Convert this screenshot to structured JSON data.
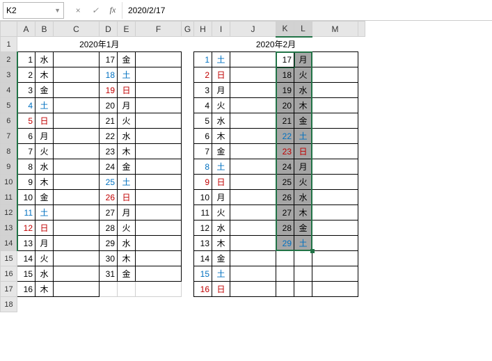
{
  "formula_bar": {
    "cell_ref": "K2",
    "value": "2020/2/17"
  },
  "icons": {
    "cancel": "×",
    "confirm": "✓",
    "fx": "fx"
  },
  "col_headers": [
    "A",
    "B",
    "C",
    "D",
    "E",
    "F",
    "G",
    "H",
    "I",
    "J",
    "K",
    "L",
    "M",
    ""
  ],
  "row_headers": [
    "1",
    "2",
    "3",
    "4",
    "5",
    "6",
    "7",
    "8",
    "9",
    "10",
    "11",
    "12",
    "13",
    "14",
    "15",
    "16",
    "17",
    "18"
  ],
  "month1": "2020年1月",
  "month2": "2020年2月",
  "jan_left": [
    {
      "d": "1",
      "w": "水"
    },
    {
      "d": "2",
      "w": "木"
    },
    {
      "d": "3",
      "w": "金"
    },
    {
      "d": "4",
      "w": "土",
      "c": "blue"
    },
    {
      "d": "5",
      "w": "日",
      "c": "red"
    },
    {
      "d": "6",
      "w": "月"
    },
    {
      "d": "7",
      "w": "火"
    },
    {
      "d": "8",
      "w": "水"
    },
    {
      "d": "9",
      "w": "木"
    },
    {
      "d": "10",
      "w": "金"
    },
    {
      "d": "11",
      "w": "土",
      "c": "blue"
    },
    {
      "d": "12",
      "w": "日",
      "c": "red"
    },
    {
      "d": "13",
      "w": "月"
    },
    {
      "d": "14",
      "w": "火"
    },
    {
      "d": "15",
      "w": "水"
    },
    {
      "d": "16",
      "w": "木"
    }
  ],
  "jan_right": [
    {
      "d": "17",
      "w": "金"
    },
    {
      "d": "18",
      "w": "土",
      "c": "blue"
    },
    {
      "d": "19",
      "w": "日",
      "c": "red"
    },
    {
      "d": "20",
      "w": "月"
    },
    {
      "d": "21",
      "w": "火"
    },
    {
      "d": "22",
      "w": "水"
    },
    {
      "d": "23",
      "w": "木"
    },
    {
      "d": "24",
      "w": "金"
    },
    {
      "d": "25",
      "w": "土",
      "c": "blue"
    },
    {
      "d": "26",
      "w": "日",
      "c": "red"
    },
    {
      "d": "27",
      "w": "月"
    },
    {
      "d": "28",
      "w": "火"
    },
    {
      "d": "29",
      "w": "水"
    },
    {
      "d": "30",
      "w": "木"
    },
    {
      "d": "31",
      "w": "金"
    }
  ],
  "feb_left": [
    {
      "d": "1",
      "w": "土",
      "c": "blue"
    },
    {
      "d": "2",
      "w": "日",
      "c": "red"
    },
    {
      "d": "3",
      "w": "月"
    },
    {
      "d": "4",
      "w": "火"
    },
    {
      "d": "5",
      "w": "水"
    },
    {
      "d": "6",
      "w": "木"
    },
    {
      "d": "7",
      "w": "金"
    },
    {
      "d": "8",
      "w": "土",
      "c": "blue"
    },
    {
      "d": "9",
      "w": "日",
      "c": "red"
    },
    {
      "d": "10",
      "w": "月"
    },
    {
      "d": "11",
      "w": "火"
    },
    {
      "d": "12",
      "w": "水"
    },
    {
      "d": "13",
      "w": "木"
    },
    {
      "d": "14",
      "w": "金"
    },
    {
      "d": "15",
      "w": "土",
      "c": "blue"
    },
    {
      "d": "16",
      "w": "日",
      "c": "red"
    }
  ],
  "feb_right": [
    {
      "d": "17",
      "w": "月"
    },
    {
      "d": "18",
      "w": "火"
    },
    {
      "d": "19",
      "w": "水"
    },
    {
      "d": "20",
      "w": "木"
    },
    {
      "d": "21",
      "w": "金"
    },
    {
      "d": "22",
      "w": "土",
      "c": "blue"
    },
    {
      "d": "23",
      "w": "日",
      "c": "red"
    },
    {
      "d": "24",
      "w": "月"
    },
    {
      "d": "25",
      "w": "火"
    },
    {
      "d": "26",
      "w": "水"
    },
    {
      "d": "27",
      "w": "木"
    },
    {
      "d": "28",
      "w": "金"
    },
    {
      "d": "29",
      "w": "土",
      "c": "blue"
    }
  ]
}
